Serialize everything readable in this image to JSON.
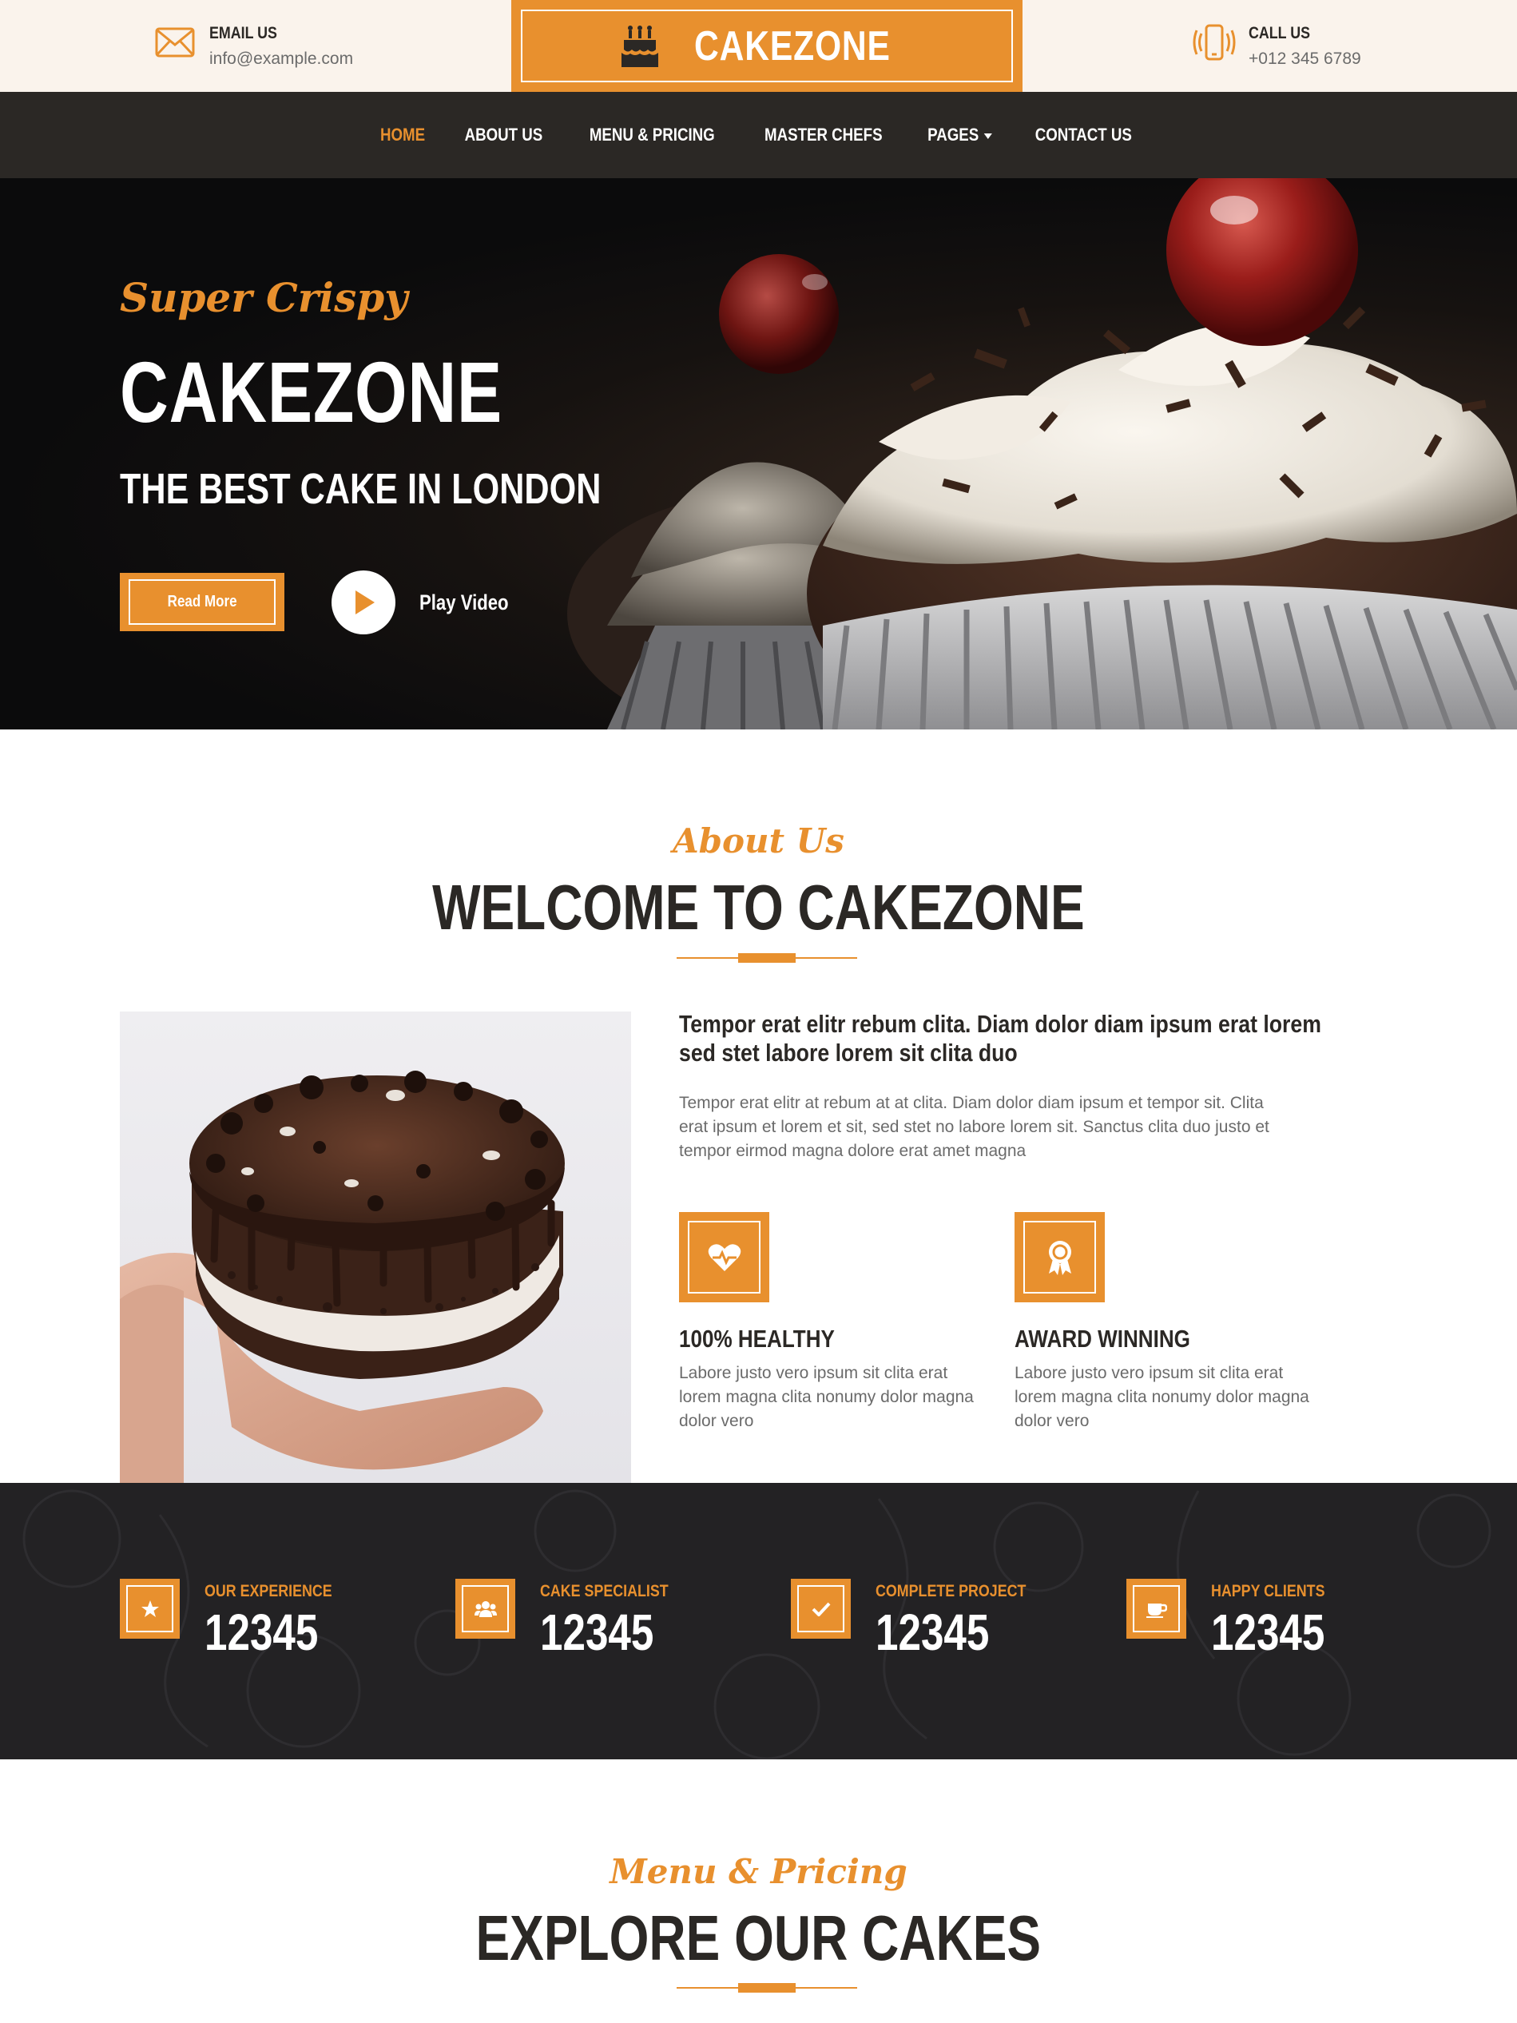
{
  "colors": {
    "accent": "#e8902e",
    "dark": "#2b2825",
    "cream": "#faf3ec",
    "stats_bg": "#232224"
  },
  "topbar": {
    "email": {
      "title": "EMAIL US",
      "value": "info@example.com",
      "icon": "envelope-icon"
    },
    "brand": {
      "name": "CAKEZONE",
      "icon": "birthday-cake-icon"
    },
    "call": {
      "title": "CALL US",
      "value": "+012 345 6789",
      "icon": "phone-vibrate-icon"
    }
  },
  "nav": {
    "items": [
      {
        "label": "HOME",
        "active": true
      },
      {
        "label": "ABOUT US"
      },
      {
        "label": "MENU & PRICING"
      },
      {
        "label": "MASTER CHEFS"
      },
      {
        "label": "PAGES",
        "dropdown": true
      },
      {
        "label": "CONTACT US"
      }
    ]
  },
  "hero": {
    "script": "Super Crispy",
    "title": "CAKEZONE",
    "subtitle": "THE BEST CAKE IN LONDON",
    "read_more": "Read More",
    "play_video": "Play Video"
  },
  "about": {
    "script": "About Us",
    "title": "WELCOME TO CAKEZONE",
    "lead": "Tempor erat elitr rebum clita. Diam dolor diam ipsum erat lorem sed stet labore lorem sit clita duo",
    "body": "Tempor erat elitr at rebum at at clita. Diam dolor diam ipsum et tempor sit. Clita erat ipsum et lorem et sit, sed stet no labore lorem sit. Sanctus clita duo justo et tempor eirmod magna dolore erat amet magna",
    "features": [
      {
        "icon": "heart-pulse-icon",
        "title": "100% HEALTHY",
        "text": "Labore justo vero ipsum sit clita erat lorem magna clita nonumy dolor magna dolor vero"
      },
      {
        "icon": "award-icon",
        "title": "AWARD WINNING",
        "text": "Labore justo vero ipsum sit clita erat lorem magna clita nonumy dolor magna dolor vero"
      }
    ]
  },
  "stats": [
    {
      "icon": "star-icon",
      "label": "OUR EXPERIENCE",
      "value": "12345"
    },
    {
      "icon": "users-icon",
      "label": "CAKE SPECIALIST",
      "value": "12345"
    },
    {
      "icon": "check-icon",
      "label": "COMPLETE PROJECT",
      "value": "12345"
    },
    {
      "icon": "coffee-icon",
      "label": "HAPPY CLIENTS",
      "value": "12345"
    }
  ],
  "menu": {
    "script": "Menu & Pricing",
    "title": "EXPLORE OUR CAKES"
  }
}
